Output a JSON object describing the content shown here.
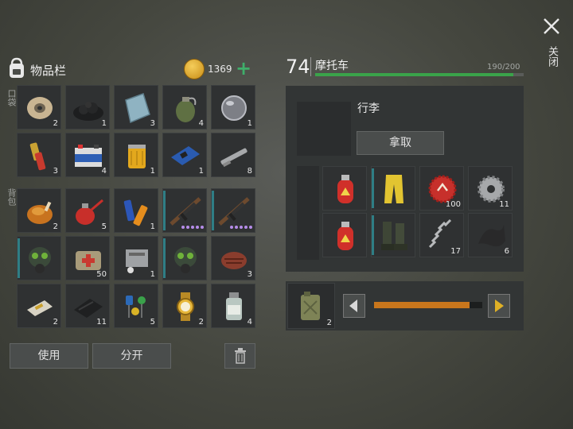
{
  "inventory": {
    "title": "物品栏",
    "coins": "1369",
    "plus_glyph": "+",
    "pocket_label": "口袋",
    "backpack_label": "背包",
    "pocket_row1": [
      "2",
      "1",
      "3",
      "4",
      "1"
    ],
    "pocket_row2": [
      "3",
      "4",
      "1",
      "1",
      "8"
    ],
    "bag_row1": [
      "2",
      "5",
      "1",
      "",
      ""
    ],
    "bag_row2": [
      "",
      "50",
      "1",
      "",
      "3"
    ],
    "bag_row3": [
      "2",
      "11",
      "5",
      "2",
      "4"
    ],
    "use_label": "使用",
    "split_label": "分开"
  },
  "vehicle": {
    "level": "74",
    "name": "摩托车",
    "capacity": "190/200",
    "capacity_fraction": 0.95,
    "luggage_title": "行李",
    "take_label": "拿取",
    "luggage_side_label": "行李",
    "slots_row1": [
      "",
      "",
      "100",
      "11"
    ],
    "slots_row2": [
      "",
      "",
      "17",
      "6"
    ],
    "fuel_count": "2",
    "fuel_slider_fraction": 0.88
  },
  "close_label": "关闭",
  "colors": {
    "accent_green": "#3aa34a",
    "slider_orange": "#c8761c",
    "teal": "#2f7e85",
    "gold": "#d9a520"
  }
}
